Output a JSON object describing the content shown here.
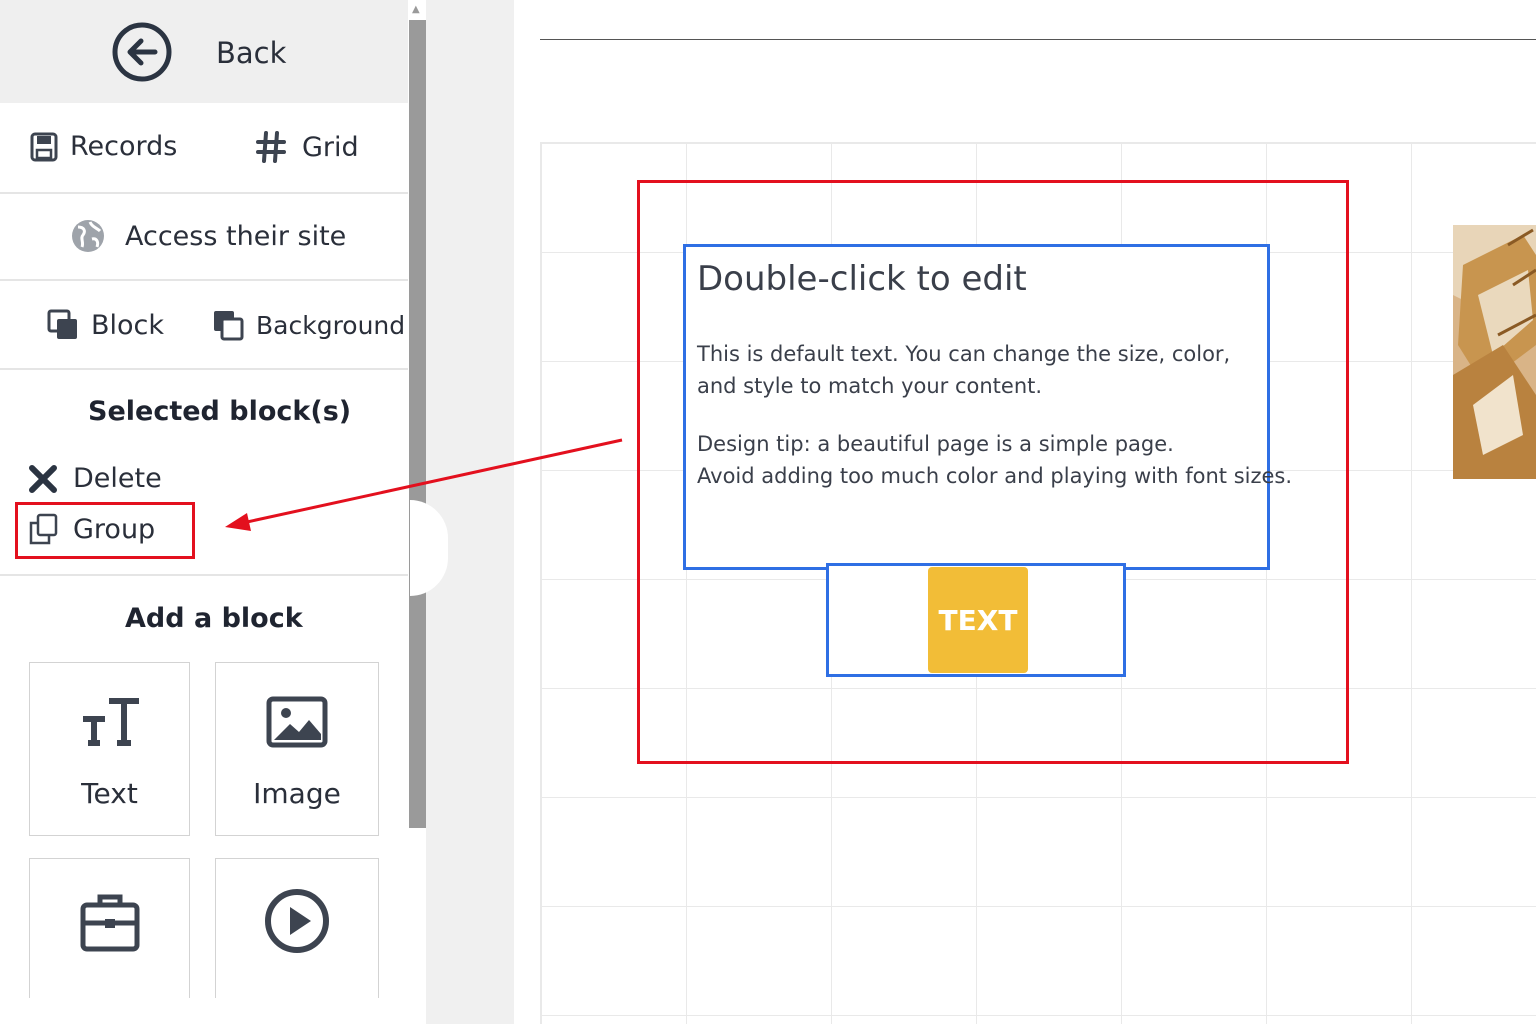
{
  "sidebar": {
    "back_label": "Back",
    "records_label": "Records",
    "grid_label": "Grid",
    "access_label": "Access their site",
    "block_label": "Block",
    "background_label": "Background",
    "selected_title": "Selected block(s)",
    "delete_label": "Delete",
    "group_label": "Group",
    "add_block_title": "Add a block",
    "tiles": [
      {
        "label": "Text",
        "icon": "text-size-icon"
      },
      {
        "label": "Image",
        "icon": "image-icon"
      },
      {
        "label": "",
        "icon": "briefcase-icon"
      },
      {
        "label": "",
        "icon": "play-icon"
      }
    ]
  },
  "canvas": {
    "text_block": {
      "title": "Double-click to edit",
      "para1_line1": "This is default text. You can change the size, color,",
      "para1_line2": "and style to match your content.",
      "para2_line1": "Design tip: a beautiful page is a simple page.",
      "para2_line2": "Avoid adding too much color and playing with font sizes."
    },
    "button_label": "TEXT"
  },
  "colors": {
    "selection": "#e3101e",
    "block_outline": "#2f6fe4",
    "button": "#f2bd37",
    "icon": "#3d4450"
  }
}
